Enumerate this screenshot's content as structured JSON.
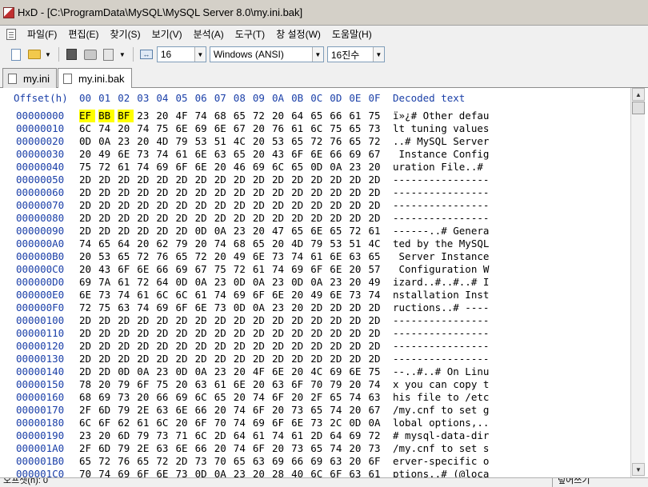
{
  "window": {
    "title": "HxD - [C:\\ProgramData\\MySQL\\MySQL Server 8.0\\my.ini.bak]",
    "app_icon": "hxd-app-icon"
  },
  "menu": {
    "items": [
      "파일(F)",
      "편집(E)",
      "찾기(S)",
      "보기(V)",
      "분석(A)",
      "도구(T)",
      "창 설정(W)",
      "도움말(H)"
    ]
  },
  "toolbar": {
    "icons": [
      "new-file-icon",
      "open-file-icon",
      "save-icon",
      "print-icon",
      "file-properties-icon",
      "bytes-per-row-icon"
    ],
    "bytes_per_row": "16",
    "charset": "Windows (ANSI)",
    "offset_base": "16진수"
  },
  "tabs": [
    {
      "label": "my.ini",
      "active": false
    },
    {
      "label": "my.ini.bak",
      "active": true
    }
  ],
  "hex": {
    "offset_label": "Offset(h)",
    "columns": [
      "00",
      "01",
      "02",
      "03",
      "04",
      "05",
      "06",
      "07",
      "08",
      "09",
      "0A",
      "0B",
      "0C",
      "0D",
      "0E",
      "0F"
    ],
    "decoded_label": "Decoded text",
    "highlight_color": "#ffff00",
    "rows": [
      {
        "offset": "00000000",
        "bytes": [
          "EF",
          "BB",
          "BF",
          "23",
          "20",
          "4F",
          "74",
          "68",
          "65",
          "72",
          "20",
          "64",
          "65",
          "66",
          "61",
          "75"
        ],
        "text": "ï»¿# Other defau"
      },
      {
        "offset": "00000010",
        "bytes": [
          "6C",
          "74",
          "20",
          "74",
          "75",
          "6E",
          "69",
          "6E",
          "67",
          "20",
          "76",
          "61",
          "6C",
          "75",
          "65",
          "73"
        ],
        "text": "lt tuning values"
      },
      {
        "offset": "00000020",
        "bytes": [
          "0D",
          "0A",
          "23",
          "20",
          "4D",
          "79",
          "53",
          "51",
          "4C",
          "20",
          "53",
          "65",
          "72",
          "76",
          "65",
          "72"
        ],
        "text": "..# MySQL Server"
      },
      {
        "offset": "00000030",
        "bytes": [
          "20",
          "49",
          "6E",
          "73",
          "74",
          "61",
          "6E",
          "63",
          "65",
          "20",
          "43",
          "6F",
          "6E",
          "66",
          "69",
          "67"
        ],
        "text": " Instance Config"
      },
      {
        "offset": "00000040",
        "bytes": [
          "75",
          "72",
          "61",
          "74",
          "69",
          "6F",
          "6E",
          "20",
          "46",
          "69",
          "6C",
          "65",
          "0D",
          "0A",
          "23",
          "20"
        ],
        "text": "uration File..# "
      },
      {
        "offset": "00000050",
        "bytes": [
          "2D",
          "2D",
          "2D",
          "2D",
          "2D",
          "2D",
          "2D",
          "2D",
          "2D",
          "2D",
          "2D",
          "2D",
          "2D",
          "2D",
          "2D",
          "2D"
        ],
        "text": "----------------"
      },
      {
        "offset": "00000060",
        "bytes": [
          "2D",
          "2D",
          "2D",
          "2D",
          "2D",
          "2D",
          "2D",
          "2D",
          "2D",
          "2D",
          "2D",
          "2D",
          "2D",
          "2D",
          "2D",
          "2D"
        ],
        "text": "----------------"
      },
      {
        "offset": "00000070",
        "bytes": [
          "2D",
          "2D",
          "2D",
          "2D",
          "2D",
          "2D",
          "2D",
          "2D",
          "2D",
          "2D",
          "2D",
          "2D",
          "2D",
          "2D",
          "2D",
          "2D"
        ],
        "text": "----------------"
      },
      {
        "offset": "00000080",
        "bytes": [
          "2D",
          "2D",
          "2D",
          "2D",
          "2D",
          "2D",
          "2D",
          "2D",
          "2D",
          "2D",
          "2D",
          "2D",
          "2D",
          "2D",
          "2D",
          "2D"
        ],
        "text": "----------------"
      },
      {
        "offset": "00000090",
        "bytes": [
          "2D",
          "2D",
          "2D",
          "2D",
          "2D",
          "2D",
          "0D",
          "0A",
          "23",
          "20",
          "47",
          "65",
          "6E",
          "65",
          "72",
          "61"
        ],
        "text": "------..# Genera"
      },
      {
        "offset": "000000A0",
        "bytes": [
          "74",
          "65",
          "64",
          "20",
          "62",
          "79",
          "20",
          "74",
          "68",
          "65",
          "20",
          "4D",
          "79",
          "53",
          "51",
          "4C"
        ],
        "text": "ted by the MySQL"
      },
      {
        "offset": "000000B0",
        "bytes": [
          "20",
          "53",
          "65",
          "72",
          "76",
          "65",
          "72",
          "20",
          "49",
          "6E",
          "73",
          "74",
          "61",
          "6E",
          "63",
          "65"
        ],
        "text": " Server Instance"
      },
      {
        "offset": "000000C0",
        "bytes": [
          "20",
          "43",
          "6F",
          "6E",
          "66",
          "69",
          "67",
          "75",
          "72",
          "61",
          "74",
          "69",
          "6F",
          "6E",
          "20",
          "57"
        ],
        "text": " Configuration W"
      },
      {
        "offset": "000000D0",
        "bytes": [
          "69",
          "7A",
          "61",
          "72",
          "64",
          "0D",
          "0A",
          "23",
          "0D",
          "0A",
          "23",
          "0D",
          "0A",
          "23",
          "20",
          "49"
        ],
        "text": "izard..#..#..# I"
      },
      {
        "offset": "000000E0",
        "bytes": [
          "6E",
          "73",
          "74",
          "61",
          "6C",
          "6C",
          "61",
          "74",
          "69",
          "6F",
          "6E",
          "20",
          "49",
          "6E",
          "73",
          "74"
        ],
        "text": "nstallation Inst"
      },
      {
        "offset": "000000F0",
        "bytes": [
          "72",
          "75",
          "63",
          "74",
          "69",
          "6F",
          "6E",
          "73",
          "0D",
          "0A",
          "23",
          "20",
          "2D",
          "2D",
          "2D",
          "2D"
        ],
        "text": "ructions..# ----"
      },
      {
        "offset": "00000100",
        "bytes": [
          "2D",
          "2D",
          "2D",
          "2D",
          "2D",
          "2D",
          "2D",
          "2D",
          "2D",
          "2D",
          "2D",
          "2D",
          "2D",
          "2D",
          "2D",
          "2D"
        ],
        "text": "----------------"
      },
      {
        "offset": "00000110",
        "bytes": [
          "2D",
          "2D",
          "2D",
          "2D",
          "2D",
          "2D",
          "2D",
          "2D",
          "2D",
          "2D",
          "2D",
          "2D",
          "2D",
          "2D",
          "2D",
          "2D"
        ],
        "text": "----------------"
      },
      {
        "offset": "00000120",
        "bytes": [
          "2D",
          "2D",
          "2D",
          "2D",
          "2D",
          "2D",
          "2D",
          "2D",
          "2D",
          "2D",
          "2D",
          "2D",
          "2D",
          "2D",
          "2D",
          "2D"
        ],
        "text": "----------------"
      },
      {
        "offset": "00000130",
        "bytes": [
          "2D",
          "2D",
          "2D",
          "2D",
          "2D",
          "2D",
          "2D",
          "2D",
          "2D",
          "2D",
          "2D",
          "2D",
          "2D",
          "2D",
          "2D",
          "2D"
        ],
        "text": "----------------"
      },
      {
        "offset": "00000140",
        "bytes": [
          "2D",
          "2D",
          "0D",
          "0A",
          "23",
          "0D",
          "0A",
          "23",
          "20",
          "4F",
          "6E",
          "20",
          "4C",
          "69",
          "6E",
          "75"
        ],
        "text": "--..#..# On Linu"
      },
      {
        "offset": "00000150",
        "bytes": [
          "78",
          "20",
          "79",
          "6F",
          "75",
          "20",
          "63",
          "61",
          "6E",
          "20",
          "63",
          "6F",
          "70",
          "79",
          "20",
          "74"
        ],
        "text": "x you can copy t"
      },
      {
        "offset": "00000160",
        "bytes": [
          "68",
          "69",
          "73",
          "20",
          "66",
          "69",
          "6C",
          "65",
          "20",
          "74",
          "6F",
          "20",
          "2F",
          "65",
          "74",
          "63"
        ],
        "text": "his file to /etc"
      },
      {
        "offset": "00000170",
        "bytes": [
          "2F",
          "6D",
          "79",
          "2E",
          "63",
          "6E",
          "66",
          "20",
          "74",
          "6F",
          "20",
          "73",
          "65",
          "74",
          "20",
          "67"
        ],
        "text": "/my.cnf to set g"
      },
      {
        "offset": "00000180",
        "bytes": [
          "6C",
          "6F",
          "62",
          "61",
          "6C",
          "20",
          "6F",
          "70",
          "74",
          "69",
          "6F",
          "6E",
          "73",
          "2C",
          "0D",
          "0A"
        ],
        "text": "lobal options,.."
      },
      {
        "offset": "00000190",
        "bytes": [
          "23",
          "20",
          "6D",
          "79",
          "73",
          "71",
          "6C",
          "2D",
          "64",
          "61",
          "74",
          "61",
          "2D",
          "64",
          "69",
          "72"
        ],
        "text": "# mysql-data-dir"
      },
      {
        "offset": "000001A0",
        "bytes": [
          "2F",
          "6D",
          "79",
          "2E",
          "63",
          "6E",
          "66",
          "20",
          "74",
          "6F",
          "20",
          "73",
          "65",
          "74",
          "20",
          "73"
        ],
        "text": "/my.cnf to set s"
      },
      {
        "offset": "000001B0",
        "bytes": [
          "65",
          "72",
          "76",
          "65",
          "72",
          "2D",
          "73",
          "70",
          "65",
          "63",
          "69",
          "66",
          "69",
          "63",
          "20",
          "6F"
        ],
        "text": "erver-specific o"
      },
      {
        "offset": "000001C0",
        "bytes": [
          "70",
          "74",
          "69",
          "6F",
          "6E",
          "73",
          "0D",
          "0A",
          "23",
          "20",
          "28",
          "40",
          "6C",
          "6F",
          "63",
          "61"
        ],
        "text": "ptions..# (@loca"
      }
    ]
  },
  "status": {
    "offset_text": "오프셋(h): 0",
    "mode_text": "덮어쓰기"
  }
}
